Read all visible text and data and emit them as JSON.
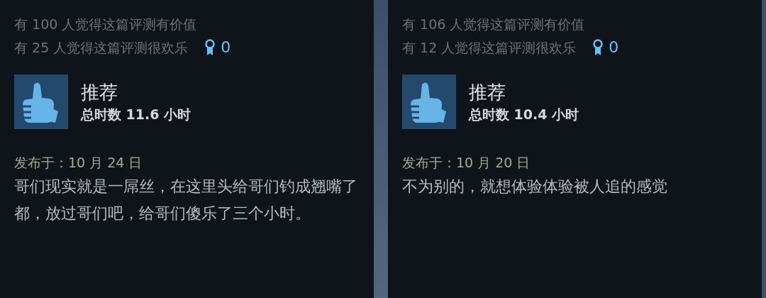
{
  "reviews": [
    {
      "helpful": "有 100 人觉得这篇评测有价值",
      "funny": "有 25 人觉得这篇评测很欢乐",
      "awards": "0",
      "recommended": true,
      "verdict": "推荐",
      "hours": "总时数 11.6 小时",
      "posted": "发布于：10 月 24 日",
      "body": "哥们现实就是一屌丝，在这里头给哥们钓成翘嘴了都，放过哥们吧，给哥们傻乐了三个小时。"
    },
    {
      "helpful": "有 106 人觉得这篇评测有价值",
      "funny": "有 12 人觉得这篇评测很欢乐",
      "awards": "0",
      "recommended": true,
      "verdict": "推荐",
      "hours": "总时数 10.4 小时",
      "posted": "发布于：10 月 20 日",
      "body": "不为别的，就想体验体验被人追的感觉"
    }
  ]
}
